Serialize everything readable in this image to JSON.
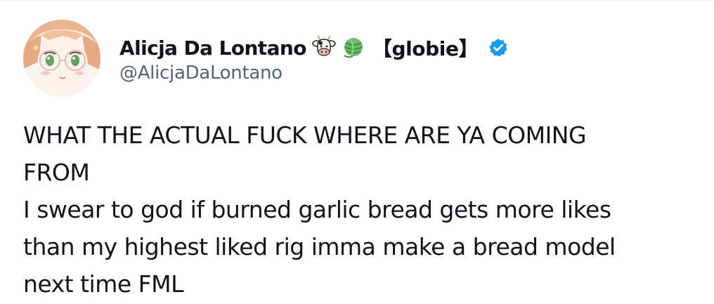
{
  "tweet": {
    "author": {
      "display_name": "Alicja Da Lontano",
      "name_emojis": [
        "cow-face-icon",
        "yarn-ball-icon"
      ],
      "name_tag": "【globie】",
      "handle": "@AlicjaDaLontano",
      "verified": true,
      "avatar": "anime-girl-with-glasses-avatar"
    },
    "text_lines": [
      "WHAT THE ACTUAL FUCK WHERE ARE YA COMING",
      "FROM",
      "I swear to god if burned garlic bread gets more likes",
      "than my highest liked rig imma make a bread model",
      "next time FML"
    ]
  },
  "colors": {
    "text": "#0f1419",
    "handle": "#536471",
    "verified_badge": "#1d9bf0",
    "background": "#ffffff"
  }
}
